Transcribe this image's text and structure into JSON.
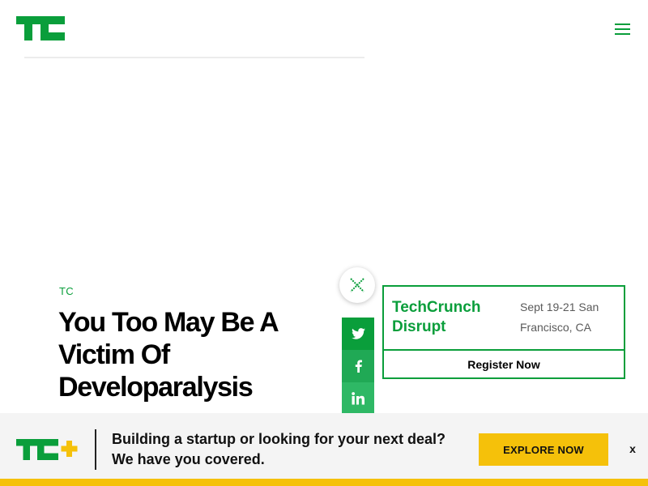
{
  "header": {
    "logo_icon": "techcrunch-logo",
    "menu_icon": "hamburger-menu-icon"
  },
  "article": {
    "category": "TC",
    "headline": "You Too May Be A Victim Of Developaralysis"
  },
  "share": {
    "close_icon": "close-icon",
    "buttons": [
      {
        "network": "twitter",
        "icon": "twitter-icon"
      },
      {
        "network": "facebook",
        "icon": "facebook-icon"
      },
      {
        "network": "linkedin",
        "icon": "linkedin-icon"
      }
    ]
  },
  "event": {
    "name": "TechCrunch Disrupt",
    "date_location": "Sept 19-21 San Francisco, CA",
    "register_label": "Register Now"
  },
  "promo": {
    "logo_icon": "tc-plus-logo",
    "message": "Building a startup or looking for your next deal? We have you covered.",
    "cta_label": "EXPLORE NOW",
    "close_label": "x"
  },
  "colors": {
    "brand_green": "#0a9e3b",
    "promo_yellow": "#f5c10a",
    "promo_background": "#f4f4f4"
  }
}
